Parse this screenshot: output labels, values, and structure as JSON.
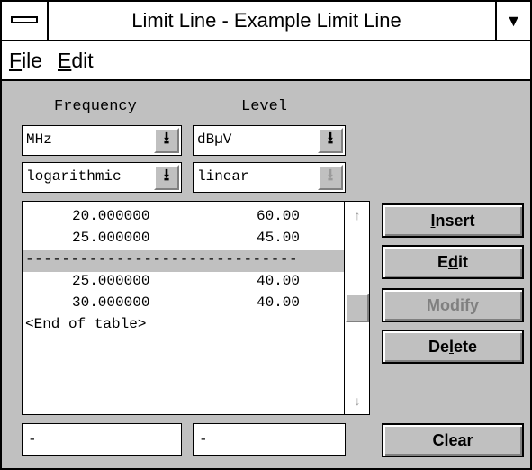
{
  "window": {
    "title": "Limit Line - Example Limit Line",
    "minimize_glyph": "▼"
  },
  "menu": {
    "items": [
      {
        "accel": "F",
        "rest": "ile"
      },
      {
        "accel": "E",
        "rest": "dit"
      }
    ]
  },
  "columns": {
    "frequency_label": "Frequency",
    "level_label": "Level"
  },
  "combos": {
    "freq_unit": "MHz",
    "level_unit": "dBµV",
    "freq_scale": "logarithmic",
    "level_scale": "linear"
  },
  "table": {
    "rows": [
      {
        "freq": "20.000000",
        "level": "60.00"
      },
      {
        "freq": "25.000000",
        "level": "45.00"
      },
      {
        "separator": "------------------------------"
      },
      {
        "freq": "25.000000",
        "level": "40.00"
      },
      {
        "freq": "30.000000",
        "level": "40.00"
      },
      {
        "end": "<End of table>"
      }
    ]
  },
  "inputs": {
    "freq_value": "-",
    "level_value": "-"
  },
  "buttons": {
    "insert": {
      "pre": "",
      "accel": "I",
      "post": "nsert"
    },
    "edit": {
      "pre": "E",
      "accel": "d",
      "post": "it"
    },
    "modify": {
      "pre": "",
      "accel": "M",
      "post": "odify"
    },
    "delete": {
      "pre": "De",
      "accel": "l",
      "post": "ete"
    },
    "clear": {
      "pre": "",
      "accel": "C",
      "post": "lear"
    }
  }
}
